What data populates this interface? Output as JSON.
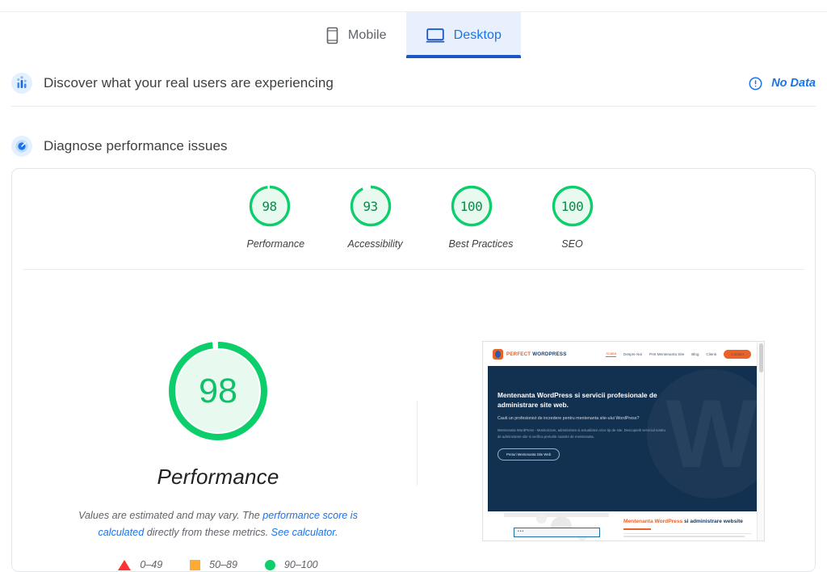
{
  "tabs": [
    {
      "label": "Mobile",
      "icon": "mobile-icon",
      "active": false
    },
    {
      "label": "Desktop",
      "icon": "desktop-icon",
      "active": true
    }
  ],
  "field_section": {
    "icon": "field-data-icon",
    "title": "Discover what your real users are experiencing",
    "status_label": "No Data",
    "status_icon": "info-circle-icon",
    "status_color": "#1a73e8"
  },
  "lab_section": {
    "icon": "diagnose-icon",
    "title": "Diagnose performance issues"
  },
  "category_scores": [
    {
      "label": "Performance",
      "value": "98",
      "color": "#0cce6b",
      "percent": 98
    },
    {
      "label": "Accessibility",
      "value": "93",
      "color": "#0cce6b",
      "percent": 93
    },
    {
      "label": "Best Practices",
      "value": "100",
      "color": "#0cce6b",
      "percent": 100
    },
    {
      "label": "SEO",
      "value": "100",
      "color": "#0cce6b",
      "percent": 100
    }
  ],
  "main_score": {
    "value": "98",
    "percent": 98,
    "title": "Performance",
    "color": "#0cce6b",
    "description_part1": "Values are estimated and may vary. The ",
    "link1": "performance score is calculated",
    "description_part2": " directly from these metrics. ",
    "link2": "See calculator",
    "description_part3": "."
  },
  "legend": [
    {
      "shape": "triangle",
      "range": "0–49",
      "color": "#ff3333"
    },
    {
      "shape": "square",
      "range": "50–89",
      "color": "#ffaa33"
    },
    {
      "shape": "circle",
      "range": "90–100",
      "color": "#0cce6b"
    }
  ],
  "thumbnail": {
    "logo_orange": "PERFECT ",
    "logo_blue": "WORDPRESS",
    "nav": [
      "Acasa",
      "Despre Noi",
      "Pret Mentenanta Site",
      "Blog",
      "Clienti"
    ],
    "cta": "Contact",
    "hero_heading": "Mentenanta WordPress si servicii profesionale de administrare site web.",
    "hero_sub": "Cauti un profesionist de incredere pentru mentenanta site-ului WordPress?",
    "hero_body": "Mentenanta WordPress - Monitorizam, administram si actualizam orice tip de site. Descoperiti serviciul nostru de administrare site si verifica preturile noastre de mentenanta.",
    "hero_button": "Preturi Mentenanta Site Web",
    "footer_title_orange": "Mentenanta WordPress ",
    "footer_title_blue": "si administrare website"
  }
}
